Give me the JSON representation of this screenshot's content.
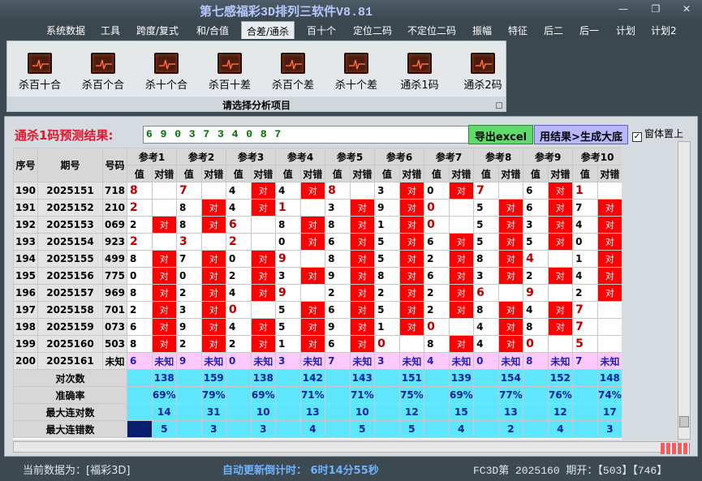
{
  "window": {
    "title": "第七感福彩3D排列三软件V8.81"
  },
  "menu": [
    "系统数据",
    "工具",
    "跨度/复式",
    "和/合值",
    "合差/通杀",
    "百十个",
    "定位二码",
    "不定位二码",
    "振幅",
    "特征",
    "后二",
    "后一",
    "计划",
    "计划2"
  ],
  "menu_active": 4,
  "ribbon": {
    "buttons": [
      "杀百十合",
      "杀百个合",
      "杀十个合",
      "杀百十差",
      "杀百个差",
      "杀十个差",
      "通杀1码",
      "通杀2码"
    ],
    "group_label": "请选择分析项目"
  },
  "prediction": {
    "label": "通杀1码预测结果:",
    "value": "6 9 0 3 7 3 4 0 8 7",
    "export_label": "导出excel",
    "generate_label": "用结果>生成大底",
    "topmost_label": "窗体置上",
    "topmost_checked": true
  },
  "table": {
    "col_seq": "序号",
    "col_period": "期号",
    "col_number": "号码",
    "ref_headers": [
      "参考1",
      "参考2",
      "参考3",
      "参考4",
      "参考5",
      "参考6",
      "参考7",
      "参考8",
      "参考9",
      "参考10"
    ],
    "sub_value": "值",
    "sub_result": "对错",
    "hit_text": "对",
    "rows": [
      {
        "seq": "190",
        "period": "2025151",
        "number": "718",
        "vals": [
          "8",
          "7",
          "4",
          "4",
          "8",
          "3",
          "0",
          "7",
          "6",
          "1"
        ],
        "hits": [
          0,
          0,
          1,
          1,
          0,
          1,
          1,
          0,
          1,
          0
        ]
      },
      {
        "seq": "191",
        "period": "2025152",
        "number": "210",
        "vals": [
          "2",
          "8",
          "4",
          "1",
          "3",
          "9",
          "0",
          "5",
          "6",
          "7"
        ],
        "hits": [
          0,
          1,
          1,
          0,
          1,
          1,
          0,
          1,
          1,
          1
        ]
      },
      {
        "seq": "192",
        "period": "2025153",
        "number": "069",
        "vals": [
          "2",
          "8",
          "6",
          "8",
          "8",
          "1",
          "0",
          "5",
          "3",
          "4"
        ],
        "hits": [
          1,
          1,
          0,
          1,
          1,
          1,
          0,
          1,
          1,
          1
        ]
      },
      {
        "seq": "193",
        "period": "2025154",
        "number": "923",
        "vals": [
          "2",
          "3",
          "2",
          "0",
          "6",
          "5",
          "6",
          "5",
          "5",
          "0"
        ],
        "hits": [
          0,
          0,
          0,
          1,
          1,
          1,
          1,
          1,
          1,
          1
        ]
      },
      {
        "seq": "194",
        "period": "2025155",
        "number": "499",
        "vals": [
          "8",
          "7",
          "0",
          "9",
          "8",
          "5",
          "2",
          "8",
          "4",
          "1"
        ],
        "hits": [
          1,
          1,
          1,
          0,
          1,
          1,
          1,
          1,
          0,
          1
        ]
      },
      {
        "seq": "195",
        "period": "2025156",
        "number": "775",
        "vals": [
          "0",
          "0",
          "2",
          "3",
          "9",
          "8",
          "6",
          "3",
          "2",
          "4"
        ],
        "hits": [
          1,
          1,
          1,
          1,
          1,
          1,
          1,
          1,
          1,
          1
        ]
      },
      {
        "seq": "196",
        "period": "2025157",
        "number": "969",
        "vals": [
          "8",
          "2",
          "4",
          "9",
          "2",
          "2",
          "2",
          "6",
          "9",
          "2"
        ],
        "hits": [
          1,
          1,
          1,
          0,
          1,
          1,
          1,
          0,
          0,
          1
        ]
      },
      {
        "seq": "197",
        "period": "2025158",
        "number": "701",
        "vals": [
          "2",
          "3",
          "0",
          "5",
          "6",
          "5",
          "2",
          "8",
          "4",
          "7"
        ],
        "hits": [
          1,
          1,
          0,
          1,
          1,
          1,
          1,
          1,
          1,
          0
        ]
      },
      {
        "seq": "198",
        "period": "2025159",
        "number": "073",
        "vals": [
          "6",
          "9",
          "4",
          "5",
          "9",
          "1",
          "0",
          "4",
          "8",
          "7"
        ],
        "hits": [
          1,
          1,
          1,
          1,
          1,
          1,
          0,
          1,
          1,
          0
        ]
      },
      {
        "seq": "199",
        "period": "2025160",
        "number": "503",
        "vals": [
          "8",
          "2",
          "2",
          "1",
          "6",
          "0",
          "8",
          "4",
          "0",
          "5"
        ],
        "hits": [
          1,
          1,
          1,
          1,
          1,
          0,
          1,
          1,
          0,
          0
        ]
      },
      {
        "seq": "200",
        "period": "2025161",
        "number": "未知",
        "vals": [
          "6",
          "9",
          "0",
          "3",
          "7",
          "3",
          "4",
          "0",
          "8",
          "7"
        ],
        "unknown": "未知"
      }
    ],
    "stats": [
      {
        "label": "对次数",
        "values": [
          "138",
          "159",
          "138",
          "142",
          "143",
          "151",
          "139",
          "154",
          "152",
          "148"
        ]
      },
      {
        "label": "准确率",
        "values": [
          "69%",
          "79%",
          "69%",
          "71%",
          "71%",
          "75%",
          "69%",
          "77%",
          "76%",
          "74%"
        ]
      },
      {
        "label": "最大连对数",
        "values": [
          "14",
          "31",
          "10",
          "13",
          "10",
          "12",
          "15",
          "13",
          "12",
          "17"
        ]
      },
      {
        "label": "最大连错数",
        "values": [
          "5",
          "3",
          "3",
          "4",
          "5",
          "5",
          "4",
          "2",
          "4",
          "3"
        ]
      }
    ]
  },
  "status": {
    "data_source": "当前数据为：[福彩3D]",
    "countdown": "自动更新倒计时： 6时14分55秒",
    "info": "FC3D第 2025160 期开：【503】【746】"
  }
}
